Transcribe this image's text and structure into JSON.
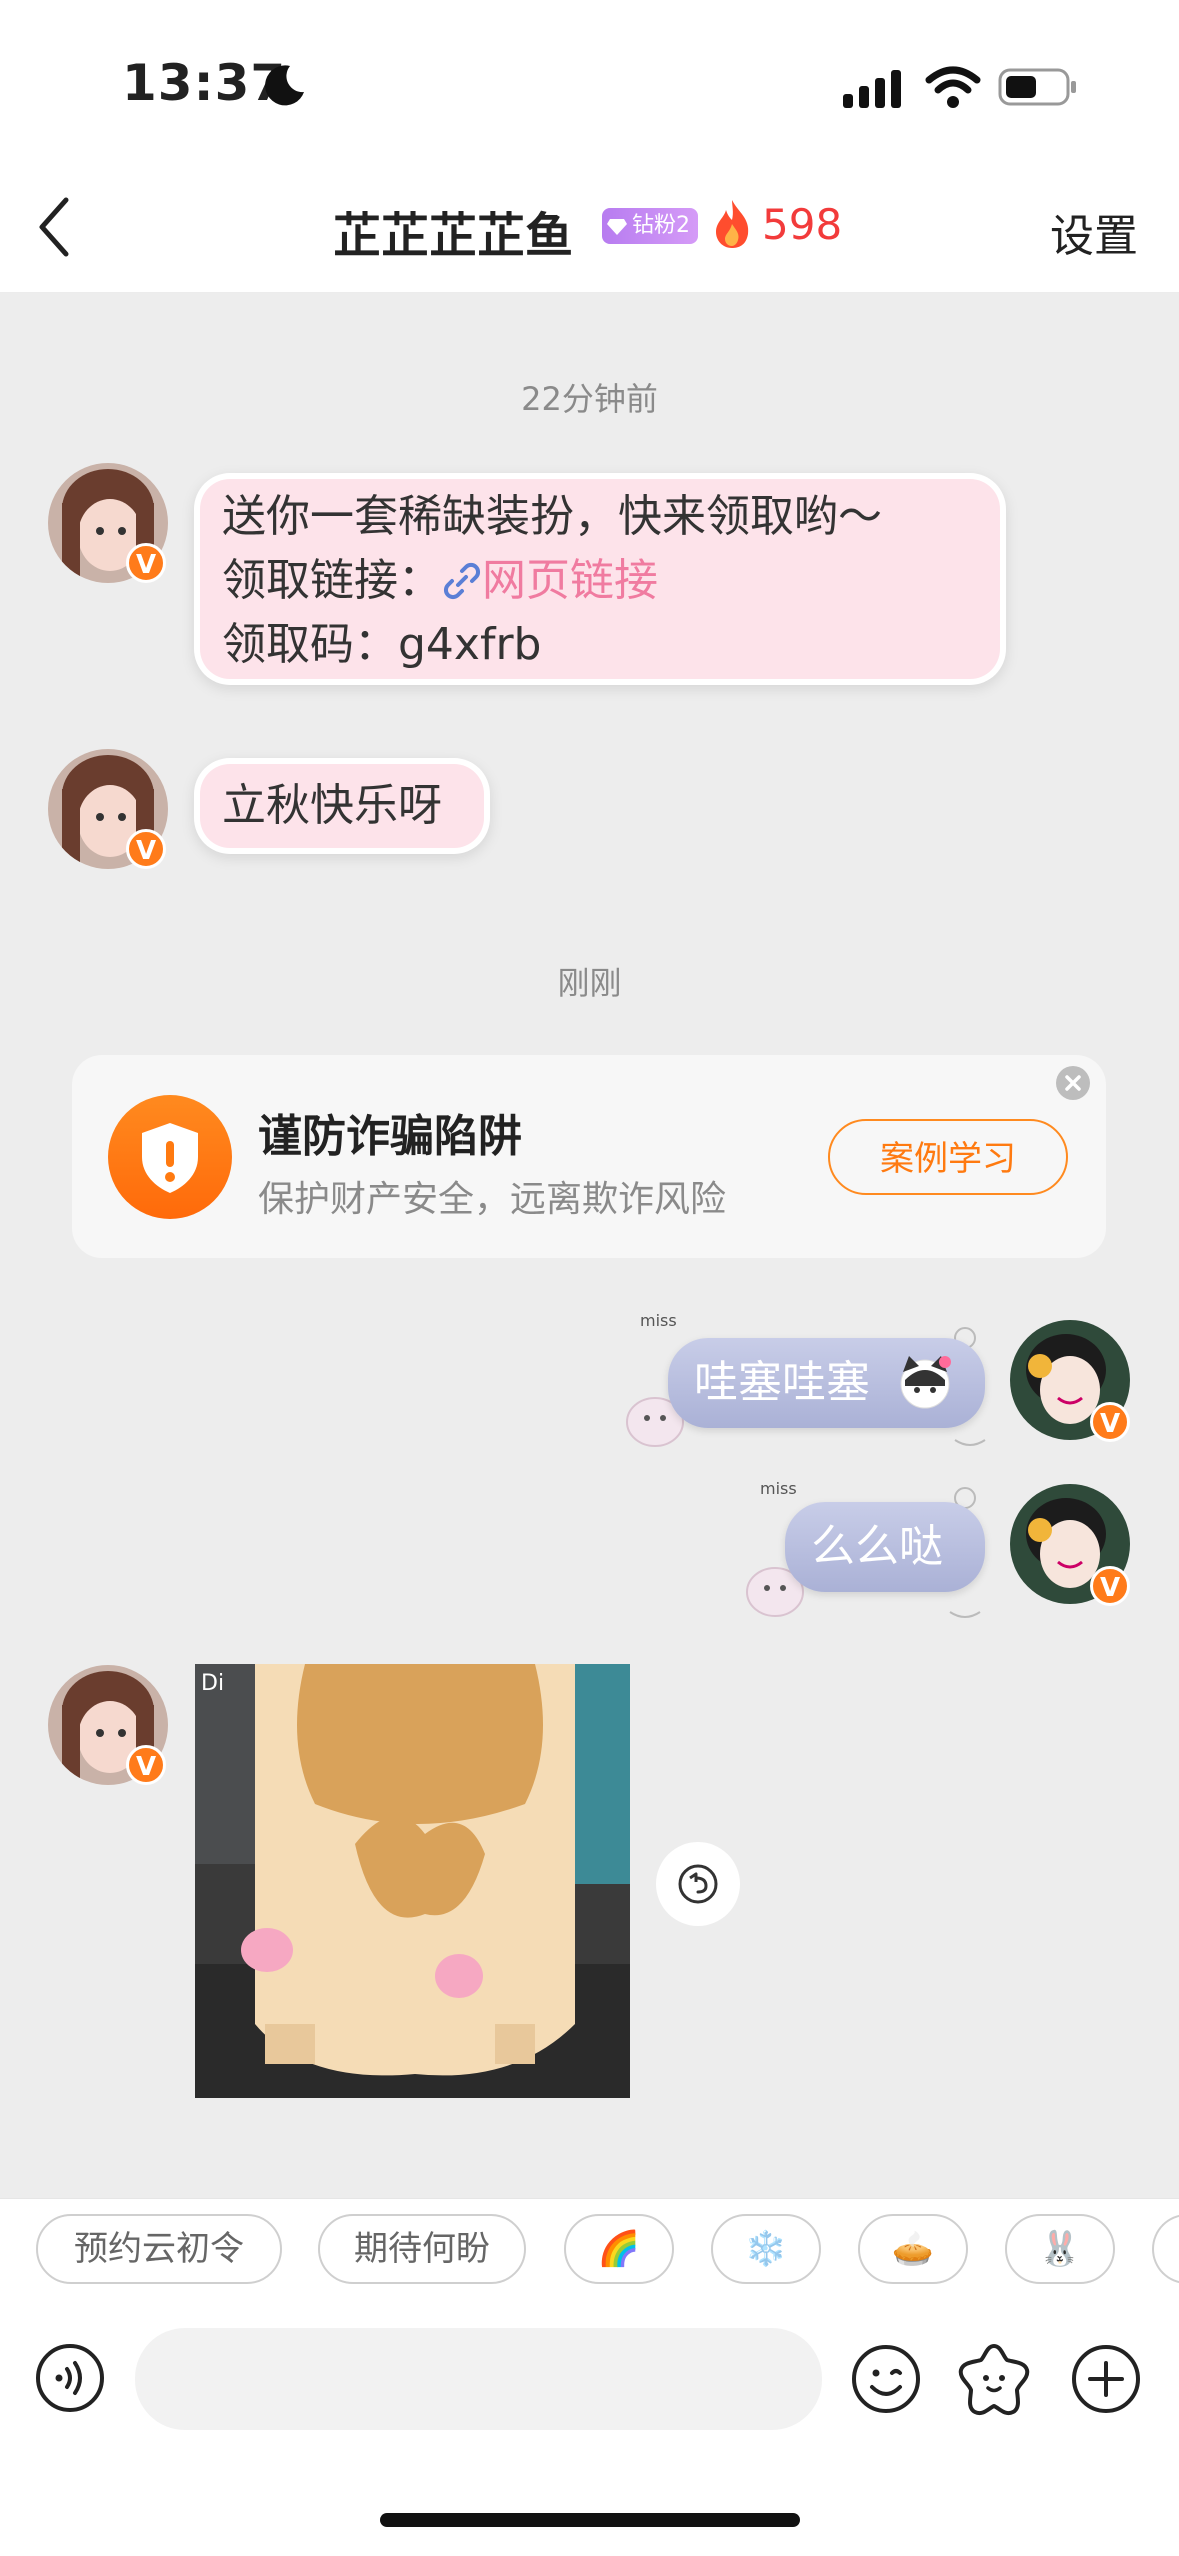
{
  "status_bar": {
    "time": "13:37"
  },
  "header": {
    "title": "芷芷芷芷鱼",
    "fan_badge": "钻粉2",
    "fire_count": "598",
    "settings_label": "设置"
  },
  "chat": {
    "divider_1": "22分钟前",
    "msg_gift": {
      "line1": "送你一套稀缺装扮，快来领取哟～",
      "line2_label": "领取链接：",
      "line2_link": "网页链接",
      "line3": "领取码：g4xfrb"
    },
    "msg_greeting": "立秋快乐呀",
    "divider_2": "刚刚",
    "fraud_card": {
      "title": "谨防诈骗陷阱",
      "subtitle": "保护财产安全，远离欺诈风险",
      "button": "案例学习"
    },
    "my_msg_1": "哇塞哇塞",
    "my_msg_2": "么么哒",
    "sticker_decor": "miss",
    "photo_watermark": "Di"
  },
  "quick_replies": [
    "预约云初令",
    "期待何盼",
    "🌈",
    "❄️",
    "🥧",
    "🐰"
  ],
  "colors": {
    "accent_orange": "#ff7a10",
    "fire_red": "#f23b3b",
    "pink_bubble": "#fde3ea",
    "blue_bubble": "#aab1d6"
  }
}
